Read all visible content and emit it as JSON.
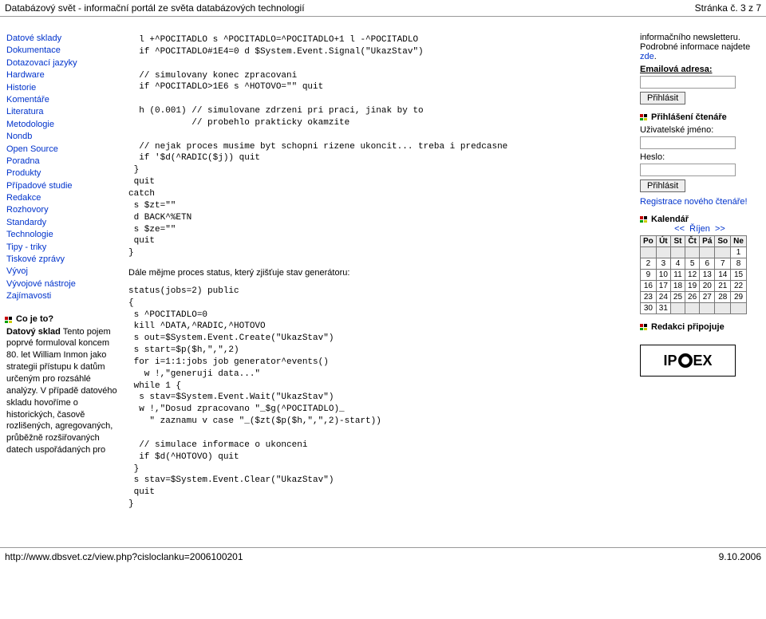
{
  "header": {
    "title": "Databázový svět - informační portál ze světa databázových technologií",
    "page_indicator": "Stránka č. 3 z 7"
  },
  "sidebar": {
    "nav": [
      "Datové sklady",
      "Dokumentace",
      "Dotazovací jazyky",
      "Hardware",
      "Historie",
      "Komentáře",
      "Literatura",
      "Metodologie",
      "Nondb",
      "Open Source",
      "Poradna",
      "Produkty",
      "Případové studie",
      "Redakce",
      "Rozhovory",
      "Standardy",
      "Technologie",
      "Tipy - triky",
      "Tiskové zprávy",
      "Vývoj",
      "Vývojové nástroje",
      "Zajímavosti"
    ],
    "what_title": "Co je to?",
    "what_term": "Datový sklad",
    "what_body": "Tento pojem poprvé formuloval koncem 80. let William Inmon jako strategii přístupu k datům určeným pro rozsáhlé analýzy. V případě datového skladu hovoříme o historických, časově rozlišených, agregovaných, průběžně rozšiřovaných datech uspořádaných pro"
  },
  "main": {
    "code1": "  l +^POCITADLO s ^POCITADLO=^POCITADLO+1 l -^POCITADLO\n  if ^POCITADLO#1E4=0 d $System.Event.Signal(\"UkazStav\")\n\n  // simulovany konec zpracovani\n  if ^POCITADLO>1E6 s ^HOTOVO=\"\" quit\n\n  h (0.001) // simulovane zdrzeni pri praci, jinak by to\n            // probehlo prakticky okamzite\n\n  // nejak proces musime byt schopni rizene ukoncit... treba i predcasne\n  if '$d(^RADIC($j)) quit\n }\n quit\ncatch\n s $zt=\"\"\n d BACK^%ETN\n s $ze=\"\"\n quit\n}",
    "para1": "Dále mějme proces status, který zjišťuje stav generátoru:",
    "code2": "status(jobs=2) public\n{\n s ^POCITADLO=0\n kill ^DATA,^RADIC,^HOTOVO\n s out=$System.Event.Create(\"UkazStav\")\n s start=$p($h,\",\",2)\n for i=1:1:jobs job generator^events()\n   w !,\"generuji data...\"\n while 1 {\n  s stav=$System.Event.Wait(\"UkazStav\")\n  w !,\"Dosud zpracovano \"_$g(^POCITADLO)_\n    \" zaznamu v case \"_($zt($p($h,\",\",2)-start))\n\n  // simulace informace o ukonceni\n  if $d(^HOTOVO) quit\n }\n s stav=$System.Event.Clear(\"UkazStav\")\n quit\n}"
  },
  "right": {
    "nl_intro": "informačního newsletteru. Podrobné informace najdete ",
    "nl_link": "zde",
    "email_label": "Emailová adresa:",
    "subscribe_btn": "Přihlásit",
    "readers_title": "Přihlášení čtenáře",
    "user_label": "Uživatelské jméno:",
    "pass_label": "Heslo:",
    "login_btn": "Přihlásit",
    "reg_link": "Registrace nového čtenáře!",
    "cal_title": "Kalendář",
    "cal_prev": "<<",
    "cal_month": "Říjen",
    "cal_next": ">>",
    "cal_days": [
      "Po",
      "Út",
      "St",
      "Čt",
      "Pá",
      "So",
      "Ne"
    ],
    "cal_rows": [
      [
        "",
        "",
        "",
        "",
        "",
        "",
        "1"
      ],
      [
        "2",
        "3",
        "4",
        "5",
        "6",
        "7",
        "8"
      ],
      [
        "9",
        "10",
        "11",
        "12",
        "13",
        "14",
        "15"
      ],
      [
        "16",
        "17",
        "18",
        "19",
        "20",
        "21",
        "22"
      ],
      [
        "23",
        "24",
        "25",
        "26",
        "27",
        "28",
        "29"
      ],
      [
        "30",
        "31",
        "",
        "",
        "",
        "",
        ""
      ]
    ],
    "sponsor_title": "Redakci připojuje",
    "sponsor_text_l": "IP",
    "sponsor_text_r": "EX"
  },
  "footer": {
    "url": "http://www.dbsvet.cz/view.php?cisloclanku=2006100201",
    "date": "9.10.2006"
  }
}
